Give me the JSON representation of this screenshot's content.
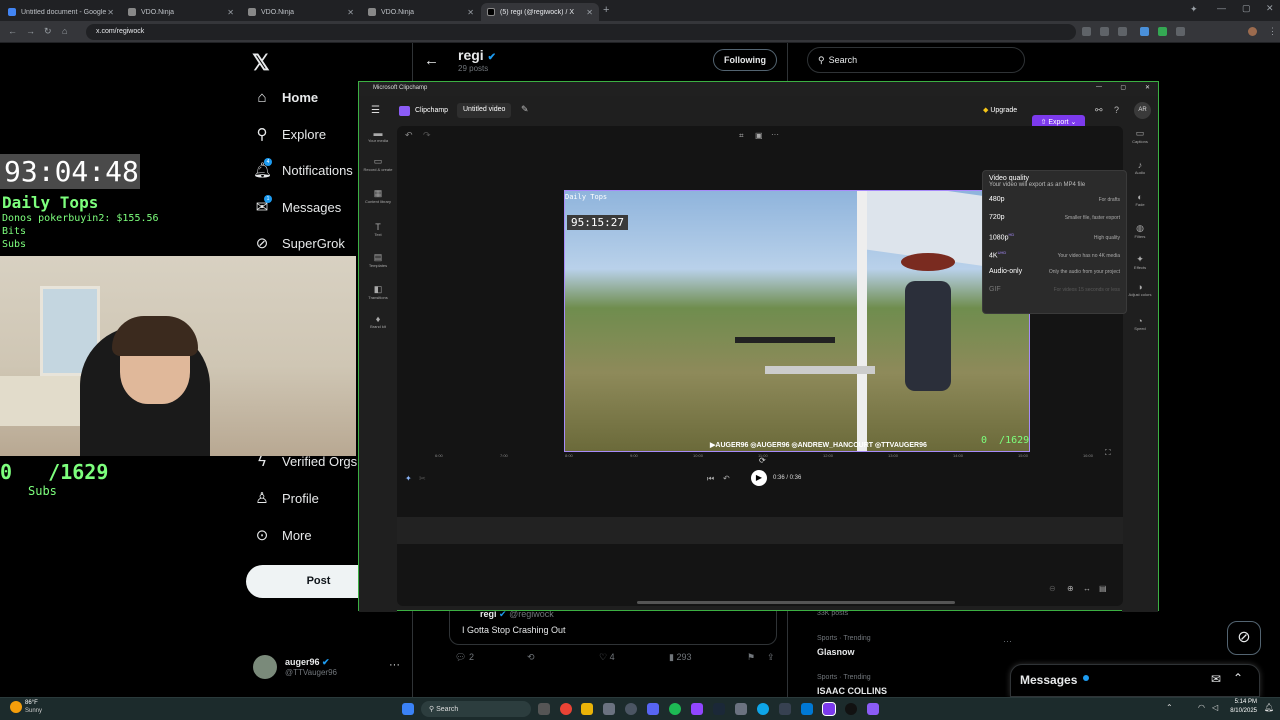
{
  "browser": {
    "tabs": [
      {
        "title": "Untitled document - Google Do",
        "color": "#4285f4"
      },
      {
        "title": "VDO.Ninja",
        "color": "#888888"
      },
      {
        "title": "VDO.Ninja",
        "color": "#888888"
      },
      {
        "title": "VDO.Ninja",
        "color": "#888888"
      },
      {
        "title": "(5) regi (@regiwock) / X",
        "color": "#000000"
      }
    ],
    "url": "x.com/regiwock"
  },
  "x": {
    "nav": [
      {
        "label": "Home",
        "icon": "home-icon",
        "glyph": "⌂"
      },
      {
        "label": "Explore",
        "icon": "search-icon",
        "glyph": "⚲"
      },
      {
        "label": "Notifications",
        "icon": "bell-icon",
        "glyph": "🔔︎",
        "badge": "4"
      },
      {
        "label": "Messages",
        "icon": "mail-icon",
        "glyph": "✉",
        "badge": "1"
      },
      {
        "label": "SuperGrok",
        "icon": "grok-icon",
        "glyph": "⊘"
      },
      {
        "label": "Verified Orgs",
        "icon": "lightning-icon",
        "glyph": "ϟ"
      },
      {
        "label": "Profile",
        "icon": "person-icon",
        "glyph": "♙"
      },
      {
        "label": "More",
        "icon": "more-circle-icon",
        "glyph": "⊙"
      }
    ],
    "post_label": "Post",
    "account": {
      "name": "auger96",
      "handle": "@TTVauger96"
    },
    "profile": {
      "name": "regi",
      "posts": "29 posts",
      "following_label": "Following"
    },
    "search_placeholder": "Search",
    "tweet": {
      "name": "regi",
      "handle": "@regiwock",
      "text": "I Gotta Stop Crashing Out",
      "replies": "2",
      "likes": "4",
      "views": "293"
    },
    "trends": [
      {
        "meta": "33K posts",
        "name": ""
      },
      {
        "meta": "Sports · Trending",
        "name": "Glasnow"
      },
      {
        "meta": "Sports · Trending",
        "name": "ISAAC COLLINS"
      }
    ],
    "messages_label": "Messages"
  },
  "overlay": {
    "timer": "93:04:48",
    "daily_tops_title": "Daily Tops",
    "donos": "Donos pokerbuyin2: $155.56",
    "bits": "Bits",
    "subs_line": "Subs",
    "subs_count": "0   /1629",
    "subs_label": "Subs"
  },
  "clipchamp": {
    "window_title": "Microsoft Clipchamp",
    "brand": "Clipchamp",
    "project": "Untitled video",
    "upgrade": "Upgrade",
    "export": "Export",
    "avatar": "AR",
    "left_tools": [
      {
        "label": "Your media",
        "glyph": "▬"
      },
      {
        "label": "Record & create",
        "glyph": "▭"
      },
      {
        "label": "Content library",
        "glyph": "▦"
      },
      {
        "label": "Text",
        "glyph": "T"
      },
      {
        "label": "Templates",
        "glyph": "▤"
      },
      {
        "label": "Transitions",
        "glyph": "◧"
      },
      {
        "label": "Brand kit",
        "glyph": "♦"
      }
    ],
    "right_tools": [
      {
        "label": "Captions",
        "glyph": "▭"
      },
      {
        "label": "Audio",
        "glyph": "♪"
      },
      {
        "label": "Fade",
        "glyph": "◐"
      },
      {
        "label": "Filters",
        "glyph": "◍"
      },
      {
        "label": "Effects",
        "glyph": "✦"
      },
      {
        "label": "Adjust colors",
        "glyph": "◑"
      },
      {
        "label": "Speed",
        "glyph": "◔"
      }
    ],
    "video_overlay": {
      "title": "Daily Tops",
      "timer": "95:15:27",
      "counter": "0  /1629",
      "credits": "▶AUGER96 ◎AUGER96 ◎ANDREW_HANCOURT ◎TTVAUGER96"
    },
    "export_menu": {
      "title": "Video quality",
      "subtitle": "Your video will export as an MP4 file",
      "options": [
        {
          "label": "480p",
          "desc": "For drafts"
        },
        {
          "label": "720p",
          "desc": "Smaller file, faster export"
        },
        {
          "label": "1080p",
          "desc": "High quality",
          "tag": "HD"
        },
        {
          "label": "4K",
          "desc": "Your video has no 4K media",
          "tag": "UHD"
        },
        {
          "label": "Audio-only",
          "desc": "Only the audio from your project"
        },
        {
          "label": "GIF",
          "desc": "For videos 15 seconds or less"
        }
      ]
    },
    "time": "0:36 / 0:36",
    "ruler": [
      "6:00",
      "7:00",
      "8:00",
      "9:00",
      "10:00",
      "11:00",
      "12:00",
      "13:00",
      "14:00",
      "15:00",
      "16:00"
    ]
  },
  "taskbar": {
    "weather_temp": "86°F",
    "weather_desc": "Sunny",
    "search": "Search",
    "time": "5:14 PM",
    "date": "8/10/2025"
  }
}
